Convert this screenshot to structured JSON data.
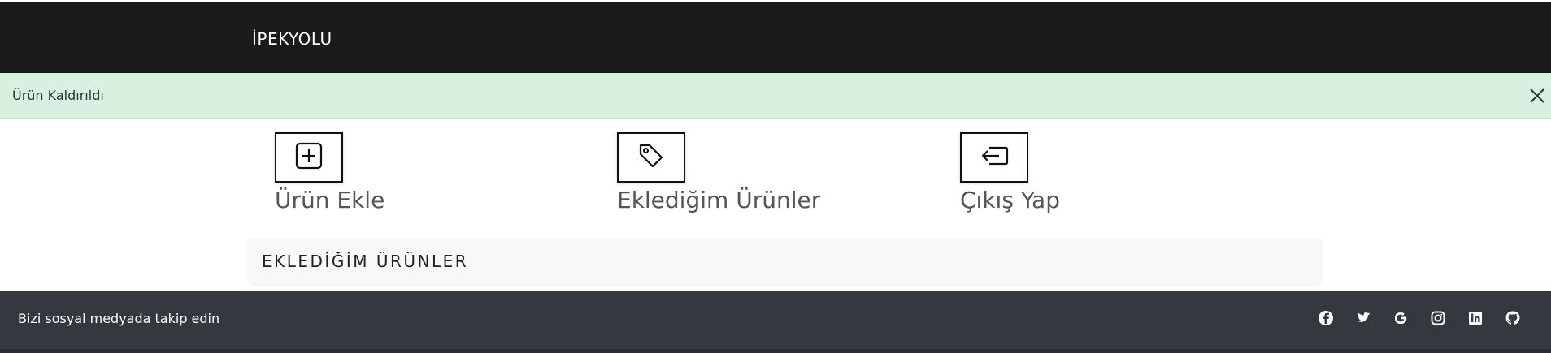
{
  "navbar": {
    "brand": "İPEKYOLU"
  },
  "alert": {
    "message": "Ürün Kaldırıldı",
    "close_icon": "close-icon"
  },
  "actions": [
    {
      "label": "Ürün Ekle",
      "icon": "plus-square-icon"
    },
    {
      "label": "Eklediğim Ürünler",
      "icon": "tag-icon"
    },
    {
      "label": "Çıkış Yap",
      "icon": "logout-icon"
    }
  ],
  "panel": {
    "title": "EKLEDİĞİM ÜRÜNLER"
  },
  "footer": {
    "follow_text": "Bizi sosyal medyada takip edin",
    "social_icons": [
      "facebook-icon",
      "twitter-icon",
      "google-icon",
      "instagram-icon",
      "linkedin-icon",
      "github-icon"
    ]
  },
  "colors": {
    "navbar_bg": "#1b1b1b",
    "alert_bg": "#d9f0e1",
    "footer_bg": "#343940",
    "panel_bg": "#f7f8f9"
  }
}
